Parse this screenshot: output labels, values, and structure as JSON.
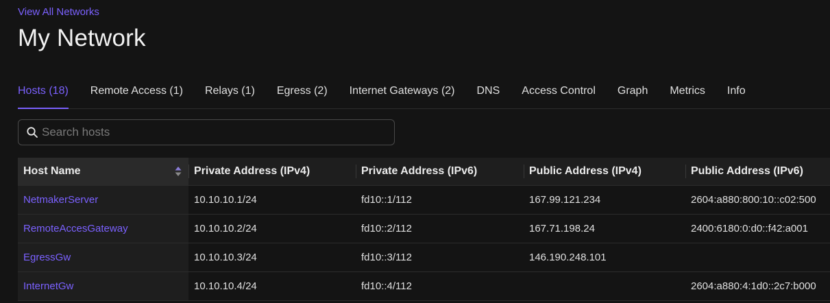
{
  "nav": {
    "back_link": "View All Networks"
  },
  "page": {
    "title": "My Network"
  },
  "tabs": [
    {
      "label": "Hosts (18)",
      "active": true
    },
    {
      "label": "Remote Access (1)"
    },
    {
      "label": "Relays (1)"
    },
    {
      "label": "Egress (2)"
    },
    {
      "label": "Internet Gateways (2)"
    },
    {
      "label": "DNS"
    },
    {
      "label": "Access Control"
    },
    {
      "label": "Graph"
    },
    {
      "label": "Metrics"
    },
    {
      "label": "Info"
    }
  ],
  "search": {
    "placeholder": "Search hosts",
    "value": ""
  },
  "table": {
    "columns": [
      "Host Name",
      "Private Address (IPv4)",
      "Private Address (IPv6)",
      "Public Address (IPv4)",
      "Public Address (IPv6)"
    ],
    "rows": [
      [
        "NetmakerServer",
        "10.10.10.1/24",
        "fd10::1/112",
        "167.99.121.234",
        "2604:a880:800:10::c02:500"
      ],
      [
        "RemoteAccesGateway",
        "10.10.10.2/24",
        "fd10::2/112",
        "167.71.198.24",
        "2400:6180:0:d0::f42:a001"
      ],
      [
        "EgressGw",
        "10.10.10.3/24",
        "fd10::3/112",
        "146.190.248.101",
        ""
      ],
      [
        "InternetGw",
        "10.10.10.4/24",
        "fd10::4/112",
        "",
        "2604:a880:4:1d0::2c7:b000"
      ]
    ]
  },
  "icons": {
    "search": "search-icon",
    "sort": "sort-icon"
  },
  "colors": {
    "accent": "#7b61ff",
    "background": "#141414",
    "header_bg": "#1e1e1e"
  }
}
